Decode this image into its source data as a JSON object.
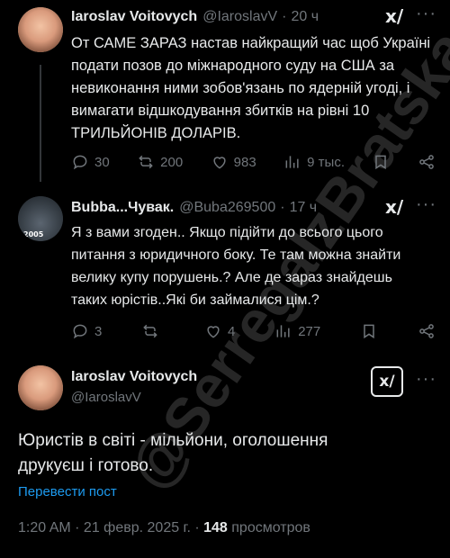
{
  "tweets": [
    {
      "name": "Iaroslav Voitovych",
      "handle": "@IaroslavV",
      "dot": "·",
      "time": "20 ч",
      "text": "От САМЕ ЗАРАЗ настав найкращий час щоб Україні подати позов до міжнародного суду на США за невиконання ними зобов'язань по ядерній угоді, і вимагати відшкодування збитків на рівні 10 ТРИЛЬЙОНІВ ДОЛАРІВ.",
      "replies": "30",
      "reposts": "200",
      "likes": "983",
      "views": "9 тыс."
    },
    {
      "name": "Bubba...Чувак.",
      "handle": "@Buba269500",
      "dot": "·",
      "time": "17 ч",
      "avatar_tag": "2005",
      "text": "Я з вами згоден.. Якщо підійти до всього цього питання з юридичного боку. Те там можна знайти велику купу порушень.? Але де зараз знайдешь таких юрістів..Які би займалися цім.?",
      "replies": "3",
      "reposts": "",
      "likes": "4",
      "views": "277"
    }
  ],
  "main": {
    "name": "Iaroslav Voitovych",
    "handle": "@IaroslavV",
    "text": "Юристів в світі - мільйони, оголошення друкуєш і готово.",
    "translate": "Перевести пост",
    "timestamp": "1:20 AM · 21 февр. 2025 г. · ",
    "views_count": "148",
    "views_label": " просмотров"
  },
  "grok_label": "x/",
  "more_label": "···",
  "watermark": "@SerregaIzBratska",
  "colors": {
    "background": "#000000",
    "text": "#e7e9ea",
    "muted": "#71767b",
    "link": "#1d9bf0"
  }
}
